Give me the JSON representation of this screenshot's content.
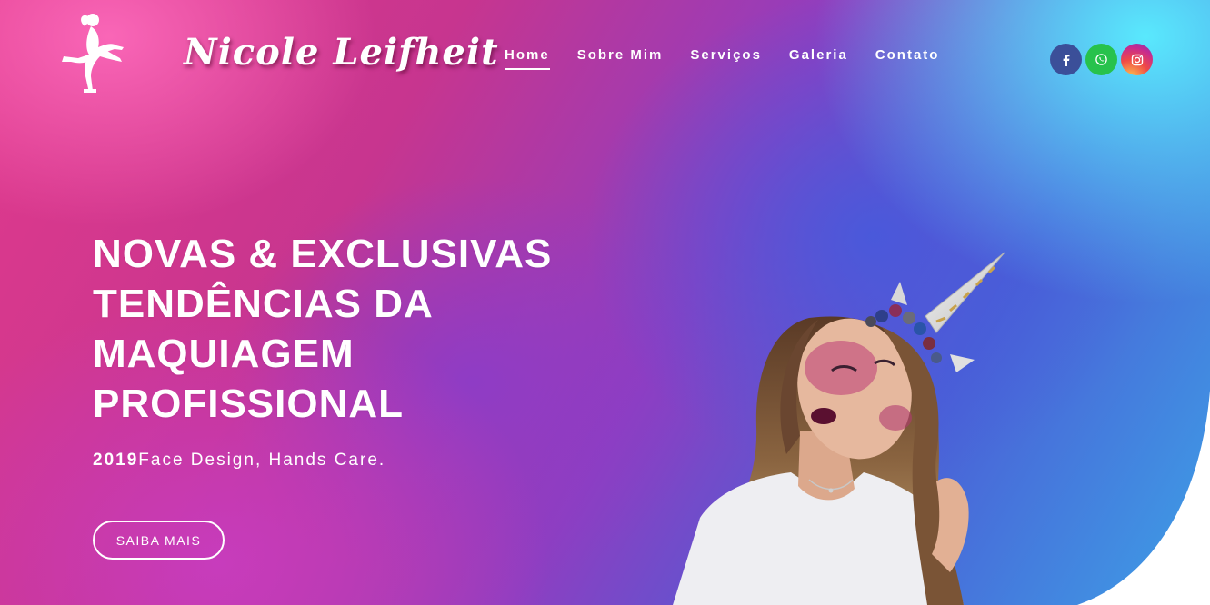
{
  "brand": {
    "name": "Nicole Leifheit"
  },
  "nav": {
    "items": [
      {
        "label": "Home",
        "active": true
      },
      {
        "label": "Sobre Mim",
        "active": false
      },
      {
        "label": "Serviços",
        "active": false
      },
      {
        "label": "Galeria",
        "active": false
      },
      {
        "label": "Contato",
        "active": false
      }
    ]
  },
  "socials": [
    {
      "icon": "facebook-icon",
      "glyph": "f",
      "color": "#3b4f99"
    },
    {
      "icon": "whatsapp-icon",
      "color": "#27c24c"
    },
    {
      "icon": "instagram-icon",
      "color": "#d6336c"
    }
  ],
  "hero": {
    "headline_lines": [
      "NOVAS & EXCLUSIVAS",
      "TENDÊNCIAS DA",
      "MAQUIAGEM",
      "PROFISSIONAL"
    ],
    "year": "2019",
    "tagline": "Face Design, Hands Care.",
    "cta_label": "SAIBA MAIS"
  },
  "colors": {
    "accent_pink": "#e03a8c",
    "accent_blue": "#3da0e6",
    "white": "#ffffff"
  }
}
